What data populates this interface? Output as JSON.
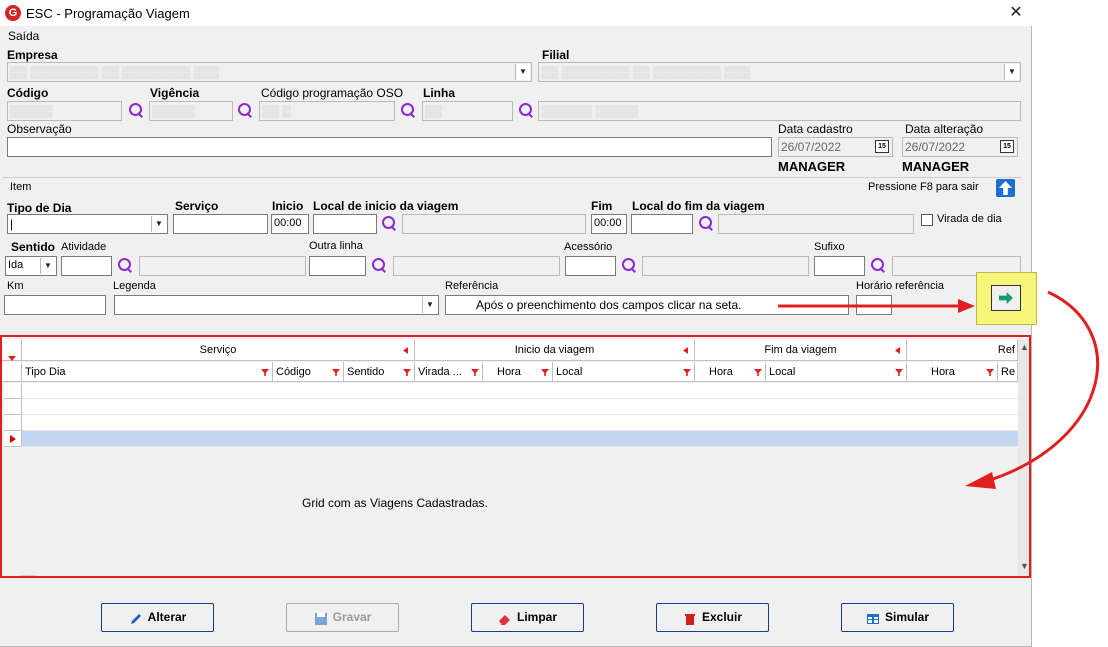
{
  "window": {
    "title": "ESC - Programação Viagem",
    "menu": "Saída"
  },
  "header": {
    "empresa_label": "Empresa",
    "filial_label": "Filial",
    "codigo_label": "Código",
    "vigencia_label": "Vigência",
    "codigo_oso_label": "Código programação OSO",
    "linha_label": "Linha",
    "observacao_label": "Observação",
    "data_cadastro_label": "Data cadastro",
    "data_cadastro_value": "26/07/2022",
    "data_alteracao_label": "Data alteração",
    "data_alteracao_value": "26/07/2022",
    "user_cadastro": "MANAGER",
    "user_alteracao": "MANAGER"
  },
  "item": {
    "section_label": "Item",
    "hint": "Pressione F8 para sair",
    "tipo_dia_label": "Tipo de Dia",
    "servico_label": "Serviço",
    "inicio_label": "Inicio",
    "inicio_value": "00:00",
    "local_inicio_label": "Local de inicio da viagem",
    "fim_label": "Fim",
    "fim_value": "00:00",
    "local_fim_label": "Local do fim da viagem",
    "virada_label": "Virada de dia",
    "sentido_label": "Sentido",
    "sentido_value": "Ida",
    "atividade_label": "Atividade",
    "outra_linha_label": "Outra linha",
    "acessorio_label": "Acessório",
    "sufixo_label": "Sufixo",
    "km_label": "Km",
    "legenda_label": "Legenda",
    "referencia_label": "Referência",
    "referencia_value": "Após o preenchimento dos campos clicar na seta.",
    "horario_ref_label": "Horário referência"
  },
  "grid": {
    "groups": [
      "Serviço",
      "Inicio da viagem",
      "Fim da viagem",
      "Ref"
    ],
    "columns": [
      "Tipo Dia",
      "Código",
      "Sentido",
      "Virada ...",
      "Hora",
      "Local",
      "Hora",
      "Local",
      "Hora",
      "Re"
    ],
    "message": "Grid com as Viagens Cadastradas."
  },
  "buttons": {
    "alterar": "Alterar",
    "gravar": "Gravar",
    "limpar": "Limpar",
    "excluir": "Excluir",
    "simular": "Simular"
  },
  "colors": {
    "highlight_red": "#e02020",
    "arrow_bg": "#f6f67a",
    "selected_row": "#c2d6f2"
  }
}
